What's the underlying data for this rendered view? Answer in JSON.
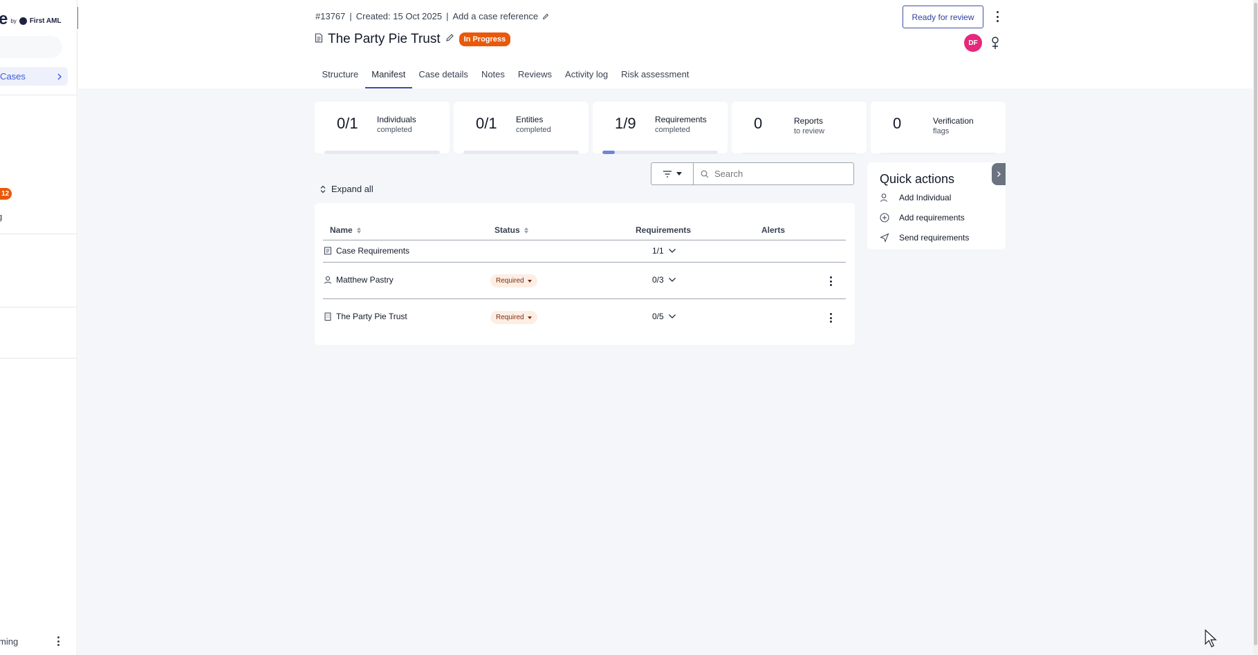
{
  "sidebar": {
    "logo_letter": "e",
    "logo_by": "by",
    "logo_brand": "First AML",
    "cases_label": "Cases",
    "badge_count": "12",
    "cut_item": "g",
    "user_name": "ming"
  },
  "header": {
    "case_number": "#13767",
    "created": "Created: 15 Oct 2025",
    "add_reference": "Add a case reference",
    "separator": "|",
    "title": "The Party Pie Trust",
    "status": "In Progress",
    "ready_button": "Ready for review",
    "avatar_initials": "DF"
  },
  "tabs": [
    {
      "label": "Structure"
    },
    {
      "label": "Manifest"
    },
    {
      "label": "Case details"
    },
    {
      "label": "Notes"
    },
    {
      "label": "Reviews"
    },
    {
      "label": "Activity log"
    },
    {
      "label": "Risk assessment"
    }
  ],
  "stats": [
    {
      "value": "0/1",
      "label": "Individuals",
      "sub": "completed",
      "progress": 0
    },
    {
      "value": "0/1",
      "label": "Entities",
      "sub": "completed",
      "progress": 0
    },
    {
      "value": "1/9",
      "label": "Requirements",
      "sub": "completed",
      "progress": 0.11
    },
    {
      "value": "0",
      "label": "Reports",
      "sub": "to review"
    },
    {
      "value": "0",
      "label": "Verification",
      "sub": "flags"
    }
  ],
  "toolbar": {
    "expand_all": "Expand all",
    "search_placeholder": "Search"
  },
  "table": {
    "columns": [
      "Name",
      "Status",
      "Requirements",
      "Alerts"
    ],
    "rows": [
      {
        "name": "Case Requirements",
        "icon": "document-icon",
        "status": "",
        "requirements": "1/1"
      },
      {
        "name": "Matthew Pastry",
        "icon": "person-icon",
        "status": "Required",
        "requirements": "0/3"
      },
      {
        "name": "The Party Pie Trust",
        "icon": "building-icon",
        "status": "Required",
        "requirements": "0/5"
      }
    ]
  },
  "quick_actions": {
    "title": "Quick actions",
    "items": [
      {
        "label": "Add Individual",
        "icon": "person-add-icon"
      },
      {
        "label": "Add requirements",
        "icon": "plus-circle-icon"
      },
      {
        "label": "Send requirements",
        "icon": "send-icon"
      }
    ]
  },
  "colors": {
    "accent": "#3b4da8",
    "status_orange": "#e8590c",
    "avatar_pink": "#e6287c",
    "required_bg": "#fdeee4",
    "progress_fill": "#6f86d6"
  }
}
